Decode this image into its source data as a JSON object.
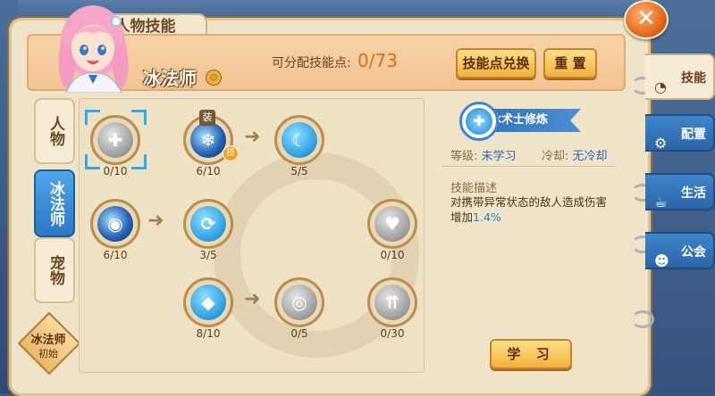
{
  "window": {
    "title": "人物技能",
    "close_icon": "close-x-icon"
  },
  "header": {
    "class_name": "冰法师",
    "points_label": "可分配技能点:",
    "points_value": "0/73",
    "exchange_button": "技能点兑换",
    "reset_button": "重 置"
  },
  "left_tabs": [
    {
      "label": "人物",
      "active": false
    },
    {
      "label": "冰法师",
      "active": true
    },
    {
      "label": "宠物",
      "active": false
    }
  ],
  "stage": {
    "line1": "冰法师",
    "line2": "初始"
  },
  "skills": [
    {
      "icon": "shield-plus-icon",
      "level": "0/10",
      "color": "gray",
      "selected": true
    },
    {
      "icon": "ice-crystal-icon",
      "level": "6/10",
      "color": "dark",
      "tag_equip": "装",
      "tag_ji": "技"
    },
    {
      "icon": "moon-plus-icon",
      "level": "5/5",
      "color": "blue"
    },
    {
      "icon": "vortex-orb-icon",
      "level": "6/10",
      "color": "dark"
    },
    {
      "icon": "cycle-arrows-icon",
      "level": "3/5",
      "color": "blue"
    },
    {
      "icon": "heart-plus-icon",
      "level": "0/10",
      "color": "gray"
    },
    {
      "icon": "diamond-icon",
      "level": "8/10",
      "color": "blue"
    },
    {
      "icon": "swirl-icon",
      "level": "0/5",
      "color": "gray"
    },
    {
      "icon": "triple-up-arrows-icon",
      "level": "0/30",
      "color": "gray"
    }
  ],
  "detail": {
    "skill_name": "冰术士修炼",
    "level_label": "等级:",
    "level_value": "未学习",
    "cooldown_label": "冷却:",
    "cooldown_value": "无冷却",
    "desc_title": "技能描述",
    "desc_text": "对携带异常状态的敌人造成伤害增加",
    "desc_value": "1.4%",
    "learn_button": "学 习"
  },
  "right_tabs": [
    {
      "label": "技能",
      "icon": "skill-swirl-icon",
      "active": true
    },
    {
      "label": "配置",
      "icon": "gear-icon",
      "active": false
    },
    {
      "label": "生活",
      "icon": "cup-icon",
      "active": false
    },
    {
      "label": "公会",
      "icon": "people-icon",
      "active": false
    }
  ]
}
